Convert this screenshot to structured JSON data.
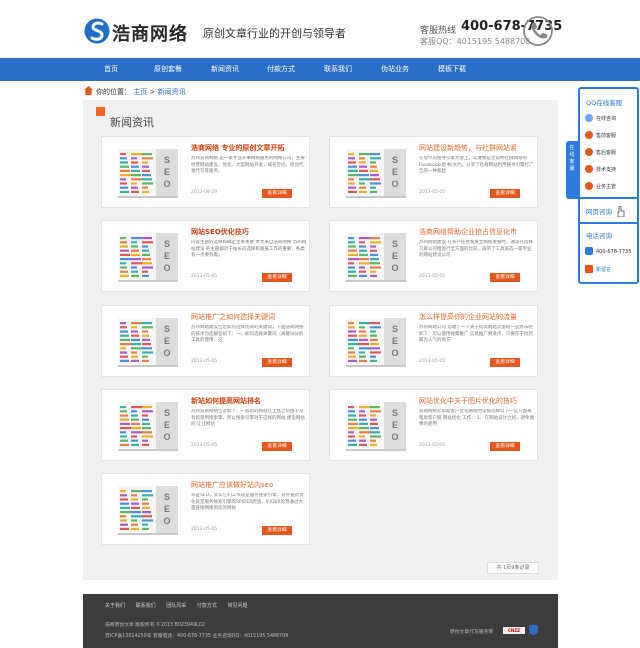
{
  "header": {
    "brand": "浩商网络",
    "slogan": "原创文章行业的开创与领导者",
    "hotline_label": "客服热线",
    "hotline_number": "400-678-7735",
    "qq_line": "客服QQ：4015195 5488708"
  },
  "nav": {
    "items": [
      "首页",
      "原创套餐",
      "新闻资讯",
      "付款方式",
      "联系我们",
      "伪站业务",
      "模板下载"
    ]
  },
  "breadcrumb": {
    "label": "你的位置：",
    "home": "主页",
    "sep": ">",
    "current": "新闻资讯"
  },
  "page_title": "新闻资讯",
  "articles": [
    {
      "title": "浩商网络  专业的原创文章开拓",
      "style": "red",
      "desc": "苏州浩商网络 是一家专业从事网络服务的网络公司，主要经营网站建设、优化、大型网站开发，域名空间，原创代发代写等服务。",
      "date": "2013-08-29",
      "button": "查看详细"
    },
    {
      "title": "网站建设新趋势，与社群网站紧",
      "style": "orange",
      "desc": "在现今的搜寻引擎大会上，又谁想是否说明社群网站的Facebook(脸书)大约。分享了社群网站利用搜寻引擎打广告的一种新趋",
      "date": "2013-05-05",
      "button": "查看详细"
    },
    {
      "title": "网站SEO优化技巧",
      "style": "red",
      "desc": "内容主题的选择和确定至关重要 本文来自浩商网络 苏州网站建设 的主题都对于站长的选择和发展工作的重要，各类有一点要有着。",
      "date": "2013-05-05",
      "button": "查看详细"
    },
    {
      "title": "浩商网络帮助企业抢占信息化市",
      "style": "orange",
      "desc": "苏州网站建设 在某产任者发展立网站发展时，通常在选择几家公司推进行全方面的比较，再带了工具再选一家专业的网站建设公司",
      "date": "2013-05-05",
      "button": "查看详细"
    },
    {
      "title": "网站推广之如何选择关键词",
      "style": "orange",
      "desc": "苏州网站建设告您如何选择优质的关键词，下面浩商网络的技术为您解答如下：一、如何选择关键词（关键词分析工具的使用：这",
      "date": "2013-05-05",
      "button": "查看详细"
    },
    {
      "title": "怎么样提高你的企业网站的流量",
      "style": "orange",
      "desc": "苏州网站公司 您收了一下关于提高网站流量的一些办法吧如下：可以使用搜集推广 信息推广频道点，只要在于找到最为人气的地方",
      "date": "2013-05-05",
      "button": "查看详细"
    },
    {
      "title": "新站如何提高网站排名",
      "style": "red",
      "desc": "苏州浩商网络告诉如下：一般新的网站在上线之初由于没有权受到搜索擎，所以搜索引擎对于这样的网站 建设网站 的 让让网站",
      "date": "2013-05-05",
      "button": "查看详细"
    },
    {
      "title": "网站优化中关于图片优化的技巧",
      "style": "orange",
      "desc": "浩商网络在帮助客户优化网站时常被选择以下一些方面来帮助客户网 网站优化 工作： 1、在网站设计之初，避免图像的使用",
      "date": "2013-05-05",
      "button": "查看详细"
    },
    {
      "title": "网站推广应该做好站内seo",
      "style": "orange",
      "desc": "众是SEO，其实它们工作就是服务搜索引擎，对外链的优化就是服务搜索引擎的SPIDER爬虫，IFIDER的弊通过大量链接网络到您的网站",
      "date": "2013-05-05",
      "button": "查看详细"
    }
  ],
  "pager": "共 1页9条记录",
  "footer": {
    "links": [
      "关于我们",
      "联系我们",
      "团队风采",
      "付款方式",
      "常见问题"
    ],
    "line1": "浩商原创文章    版权所有 ©2013  B023949L02",
    "line2": "苏ICP备13014250号    客服电话：400-678-7735    业务咨询QQ：4015195  5488708",
    "right": "原创文章代写服务商",
    "cnzz": "CNZZ"
  },
  "side": {
    "tab": "在线客服",
    "qq_title": "QQ在线客服",
    "qq_items": [
      "在线咨询",
      "售前客服",
      "售后客服",
      "技术支持",
      "业务主管"
    ],
    "web_title": "网页咨询",
    "phone_title": "电话咨询",
    "phone_number": "400-678-7735",
    "message": "新留言"
  },
  "colors": {
    "nav_blue": "#2b6ec6",
    "accent_orange": "#e8561b",
    "side_blue": "#2b7be0"
  }
}
